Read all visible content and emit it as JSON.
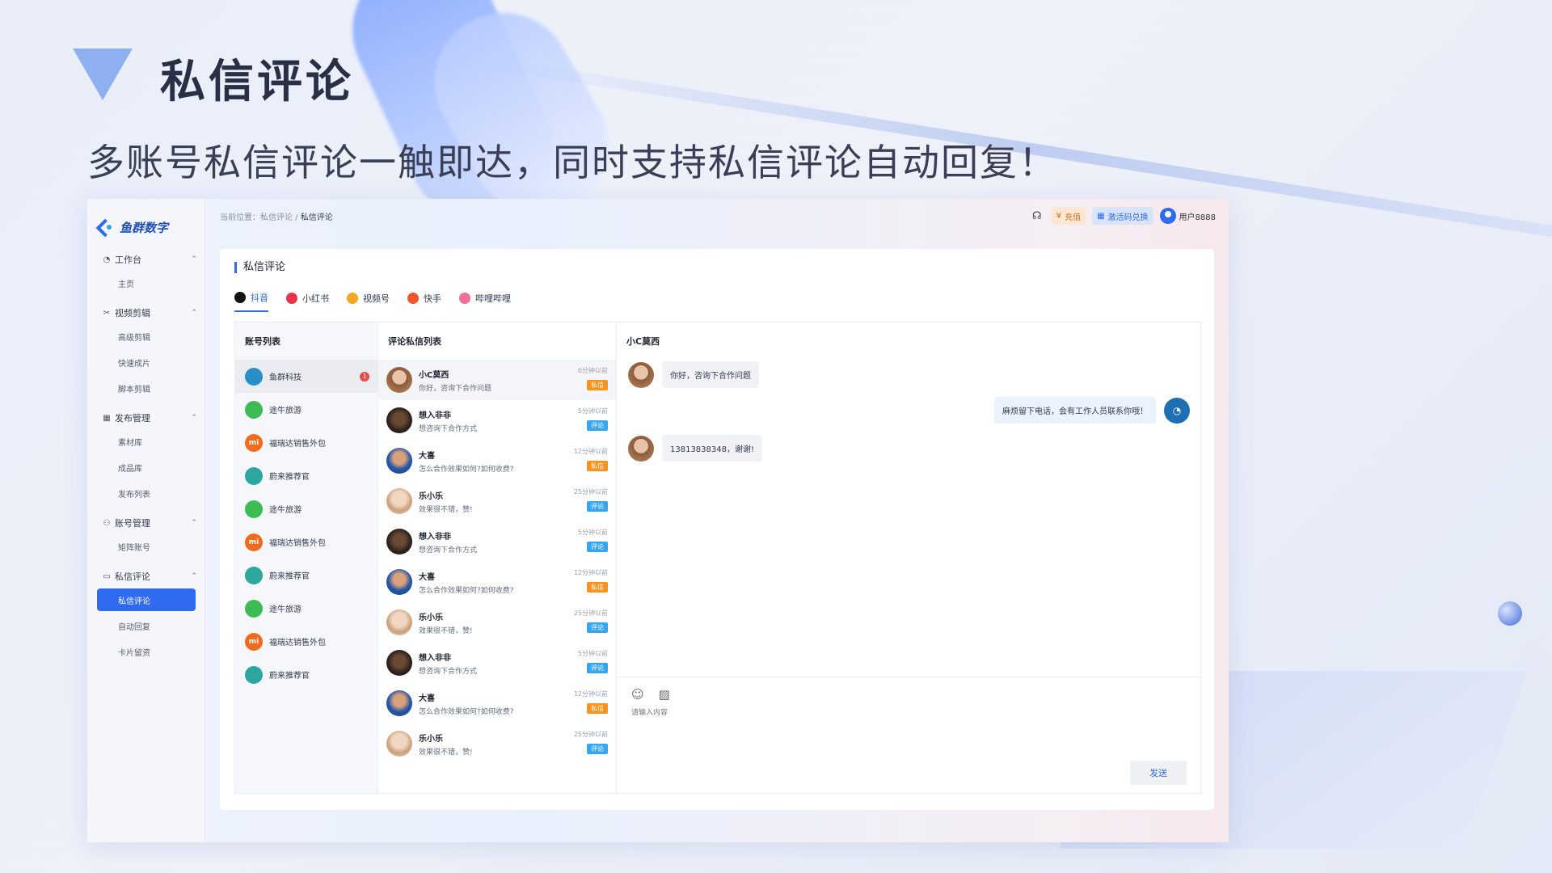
{
  "hero": {
    "title": "私信评论",
    "subtitle": "多账号私信评论一触即达，同时支持私信评论自动回复！"
  },
  "app": {
    "logo_text": "鱼群数字",
    "breadcrumb": {
      "prefix": "当前位置：",
      "parent": "私信评论",
      "sep": " / ",
      "current": "私信评论"
    },
    "topbar": {
      "charge_label": "充值",
      "code_label": "激活码兑换",
      "user_name": "用户8888"
    },
    "nav": {
      "workbench": {
        "label": "工作台",
        "items": [
          "主页"
        ]
      },
      "video_edit": {
        "label": "视频剪辑",
        "items": [
          "高级剪辑",
          "快速成片",
          "脚本剪辑"
        ]
      },
      "publish": {
        "label": "发布管理",
        "items": [
          "素材库",
          "成品库",
          "发布列表"
        ]
      },
      "account": {
        "label": "账号管理",
        "items": [
          "矩阵账号"
        ]
      },
      "dm": {
        "label": "私信评论",
        "items": [
          "私信评论",
          "自动回复",
          "卡片留资"
        ]
      }
    },
    "card_title": "私信评论",
    "tabs": [
      {
        "label": "抖音",
        "color": "#111111"
      },
      {
        "label": "小红书",
        "color": "#e8344a"
      },
      {
        "label": "视频号",
        "color": "#f5a623"
      },
      {
        "label": "快手",
        "color": "#f0582a"
      },
      {
        "label": "哔哩哔哩",
        "color": "#f06e9a"
      }
    ],
    "accounts_header": "账号列表",
    "accounts": [
      {
        "name": "鱼群科技",
        "avatar_color": "#2a8fc9",
        "badge": "1"
      },
      {
        "name": "途牛旅游",
        "avatar_color": "#3dbb54"
      },
      {
        "name": "福瑞达销售外包",
        "avatar_color": "#f26b1d",
        "glyph": "mi"
      },
      {
        "name": "蔚来推荐官",
        "avatar_color": "#2ea6a0"
      },
      {
        "name": "途牛旅游",
        "avatar_color": "#3dbb54"
      },
      {
        "name": "福瑞达销售外包",
        "avatar_color": "#f26b1d",
        "glyph": "mi"
      },
      {
        "name": "蔚来推荐官",
        "avatar_color": "#2ea6a0"
      },
      {
        "name": "途牛旅游",
        "avatar_color": "#3dbb54"
      },
      {
        "name": "福瑞达销售外包",
        "avatar_color": "#f26b1d",
        "glyph": "mi"
      },
      {
        "name": "蔚来推荐官",
        "avatar_color": "#2ea6a0"
      }
    ],
    "list_header": "评论私信列表",
    "messages": [
      {
        "name": "小C莫西",
        "text": "你好，咨询下合作问题",
        "time": "6分钟以前",
        "tag": "私信",
        "kind": "dm",
        "av": "av-a"
      },
      {
        "name": "想入非非",
        "text": "想咨询下合作方式",
        "time": "5分钟以前",
        "tag": "评论",
        "kind": "cm",
        "av": "av-b"
      },
      {
        "name": "大喜",
        "text": "怎么合作效果如何?如何收费?",
        "time": "12分钟以前",
        "tag": "私信",
        "kind": "dm",
        "av": "av-c"
      },
      {
        "name": "乐小乐",
        "text": "效果很不错，赞!",
        "time": "25分钟以前",
        "tag": "评论",
        "kind": "cm",
        "av": "av-d"
      },
      {
        "name": "想入非非",
        "text": "想咨询下合作方式",
        "time": "5分钟以前",
        "tag": "评论",
        "kind": "cm",
        "av": "av-b"
      },
      {
        "name": "大喜",
        "text": "怎么合作效果如何?如何收费?",
        "time": "12分钟以前",
        "tag": "私信",
        "kind": "dm",
        "av": "av-c"
      },
      {
        "name": "乐小乐",
        "text": "效果很不错，赞!",
        "time": "25分钟以前",
        "tag": "评论",
        "kind": "cm",
        "av": "av-d"
      },
      {
        "name": "想入非非",
        "text": "想咨询下合作方式",
        "time": "5分钟以前",
        "tag": "评论",
        "kind": "cm",
        "av": "av-b"
      },
      {
        "name": "大喜",
        "text": "怎么合作效果如何?如何收费?",
        "time": "12分钟以前",
        "tag": "私信",
        "kind": "dm",
        "av": "av-c"
      },
      {
        "name": "乐小乐",
        "text": "效果很不错，赞!",
        "time": "25分钟以前",
        "tag": "评论",
        "kind": "cm",
        "av": "av-d"
      }
    ],
    "chat": {
      "contact_name": "小C莫西",
      "messages": [
        {
          "from": "them",
          "text": "你好，咨询下合作问题"
        },
        {
          "from": "me",
          "text": "麻烦留下电话，会有工作人员联系你哦！"
        },
        {
          "from": "them",
          "text": "13813838348，谢谢!"
        }
      ],
      "input_placeholder": "请输入内容",
      "send_label": "发送"
    }
  }
}
